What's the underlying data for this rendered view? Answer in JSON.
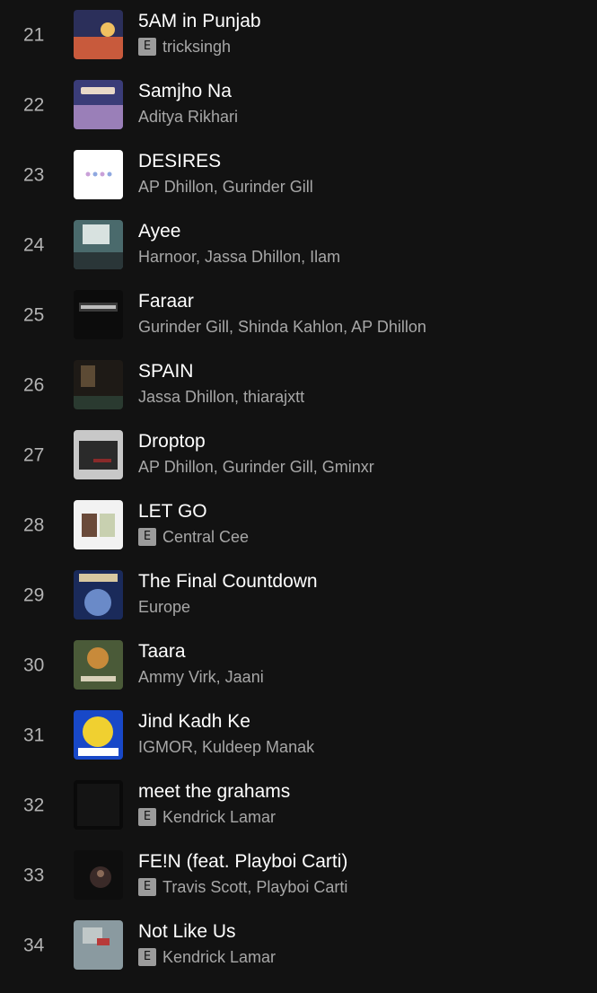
{
  "tracks": [
    {
      "number": "21",
      "title": "5AM in Punjab",
      "explicit": "E",
      "artists": "tricksingh",
      "cover_colors": [
        "#2b2f5a",
        "#c85a3c",
        "#f0c060"
      ]
    },
    {
      "number": "22",
      "title": "Samjho Na",
      "explicit": null,
      "artists": "Aditya Rikhari",
      "cover_colors": [
        "#3a3c78",
        "#9a7fb8",
        "#e8d8c8"
      ]
    },
    {
      "number": "23",
      "title": "DESIRES",
      "explicit": null,
      "artists": "AP Dhillon, Gurinder Gill",
      "cover_colors": [
        "#ffffff",
        "#c9a0d8",
        "#8fa8e0"
      ]
    },
    {
      "number": "24",
      "title": "Ayee",
      "explicit": null,
      "artists": "Harnoor, Jassa Dhillon, Ilam",
      "cover_colors": [
        "#4a6a6c",
        "#d8e2e0",
        "#2a3638"
      ]
    },
    {
      "number": "25",
      "title": "Faraar",
      "explicit": null,
      "artists": "Gurinder Gill, Shinda Kahlon, AP Dhillon",
      "cover_colors": [
        "#0c0c0c",
        "#3a3a3a",
        "#bdbdbd"
      ]
    },
    {
      "number": "26",
      "title": "SPAIN",
      "explicit": null,
      "artists": "Jassa Dhillon, thiarajxtt",
      "cover_colors": [
        "#1e1a16",
        "#5c4a34",
        "#2a3a30"
      ]
    },
    {
      "number": "27",
      "title": "Droptop",
      "explicit": null,
      "artists": "AP Dhillon, Gurinder Gill, Gminxr",
      "cover_colors": [
        "#c8c8c8",
        "#2a2a2a",
        "#8a2a2a"
      ]
    },
    {
      "number": "28",
      "title": "LET GO",
      "explicit": "E",
      "artists": "Central Cee",
      "cover_colors": [
        "#f2f2f2",
        "#6a4a3a",
        "#c8d0b0"
      ]
    },
    {
      "number": "29",
      "title": "The Final Countdown",
      "explicit": null,
      "artists": "Europe",
      "cover_colors": [
        "#1a2a5a",
        "#6a8ac8",
        "#d8c8a0"
      ]
    },
    {
      "number": "30",
      "title": "Taara",
      "explicit": null,
      "artists": "Ammy Virk, Jaani",
      "cover_colors": [
        "#4a5a38",
        "#c88a3a",
        "#d8d0b8"
      ]
    },
    {
      "number": "31",
      "title": "Jind Kadh Ke",
      "explicit": null,
      "artists": "IGMOR, Kuldeep Manak",
      "cover_colors": [
        "#1848c8",
        "#f0d030",
        "#ffffff"
      ]
    },
    {
      "number": "32",
      "title": "meet the grahams",
      "explicit": "E",
      "artists": "Kendrick Lamar",
      "cover_colors": [
        "#0a0a0a",
        "#141414",
        "#0a0a0a"
      ]
    },
    {
      "number": "33",
      "title": "FE!N (feat. Playboi Carti)",
      "explicit": "E",
      "artists": "Travis Scott, Playboi Carti",
      "cover_colors": [
        "#0e0e0e",
        "#3a2a28",
        "#8a6a58"
      ]
    },
    {
      "number": "34",
      "title": "Not Like Us",
      "explicit": "E",
      "artists": "Kendrick Lamar",
      "cover_colors": [
        "#8a9aa0",
        "#c0c8c8",
        "#b83a3a"
      ]
    }
  ]
}
